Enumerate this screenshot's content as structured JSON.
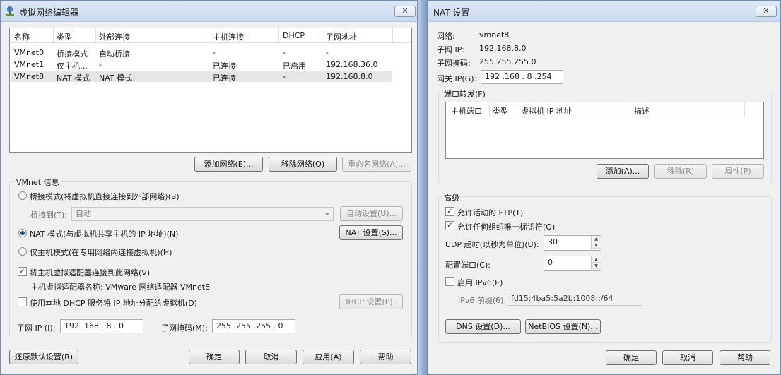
{
  "left": {
    "title": "虚拟网络编辑器",
    "close": "✕",
    "table": {
      "headers": [
        "名称",
        "类型",
        "外部连接",
        "主机连接",
        "DHCP",
        "子网地址"
      ],
      "rows": [
        [
          "VMnet0",
          "桥接模式",
          "自动桥接",
          "-",
          "-",
          "-"
        ],
        [
          "VMnet1",
          "仅主机…",
          "-",
          "已连接",
          "已启用",
          "192.168.36.0"
        ],
        [
          "VMnet8",
          "NAT 模式",
          "NAT 模式",
          "已连接",
          "-",
          "192.168.8.0"
        ]
      ]
    },
    "buttons": {
      "add_network": "添加网络(E)...",
      "remove_network": "移除网络(O)",
      "rename_network": "重命名网络(A)..."
    },
    "vmnet_info": {
      "title": "VMnet 信息",
      "bridged_mode": "桥接模式(将虚拟机直接连接到外部网络)(B)",
      "bridged_to_label": "桥接到(T):",
      "bridged_to_value": "自动",
      "auto_settings": "自动设置(U)...",
      "nat_mode": "NAT 模式(与虚拟机共享主机的 IP 地址)(N)",
      "nat_settings": "NAT 设置(S)...",
      "host_only_mode": "仅主机模式(在专用网络内连接虚拟机)(H)",
      "connect_adapter": "将主机虚拟适配器连接到此网络(V)",
      "adapter_name": "主机虚拟适配器名称: VMware 网络适配器 VMnet8",
      "use_dhcp": "使用本地 DHCP 服务将 IP 地址分配给虚拟机(D)",
      "dhcp_settings": "DHCP 设置(P)...",
      "subnet_ip_label": "子网 IP (I):",
      "subnet_ip_value": "192 .168 . 8 . 0",
      "subnet_mask_label": "子网掩码(M):",
      "subnet_mask_value": "255 .255 .255 . 0"
    },
    "footer": {
      "restore_defaults": "还原默认设置(R)",
      "ok": "确定",
      "cancel": "取消",
      "apply": "应用(A)",
      "help": "帮助"
    }
  },
  "right": {
    "title": "NAT 设置",
    "close": "✕",
    "network_label": "网络:",
    "network_value": "vmnet8",
    "subnet_ip_label": "子网 IP:",
    "subnet_ip_value": "192.168.8.0",
    "subnet_mask_label": "子网掩码:",
    "subnet_mask_value": "255.255.255.0",
    "gateway_label": "网关 IP(G):",
    "gateway_value": "192 .168 . 8 .254",
    "port_forwarding": {
      "title": "端口转发(F)",
      "headers": [
        "主机端口",
        "类型",
        "虚拟机 IP 地址",
        "描述"
      ],
      "add": "添加(A)...",
      "remove": "移除(R)",
      "properties": "属性(P)"
    },
    "advanced": {
      "title": "高级",
      "allow_ftp": "允许活动的 FTP(T)",
      "allow_any_oui": "允许任何组织唯一标识符(O)",
      "udp_timeout_label": "UDP 超时(以秒为单位)(U):",
      "udp_timeout_value": "30",
      "config_port_label": "配置端口(C):",
      "config_port_value": "0",
      "enable_ipv6": "启用 IPv6(E)",
      "ipv6_prefix_label": "IPv6 前缀(6):",
      "ipv6_prefix_value": "fd15:4ba5:5a2b:1008::/64",
      "dns_settings": "DNS 设置(D)...",
      "netbios_settings": "NetBIOS 设置(N)..."
    },
    "footer": {
      "ok": "确定",
      "cancel": "取消",
      "help": "帮助"
    }
  },
  "check_mark": "✓",
  "spin_up": "▲",
  "spin_down": "▼"
}
